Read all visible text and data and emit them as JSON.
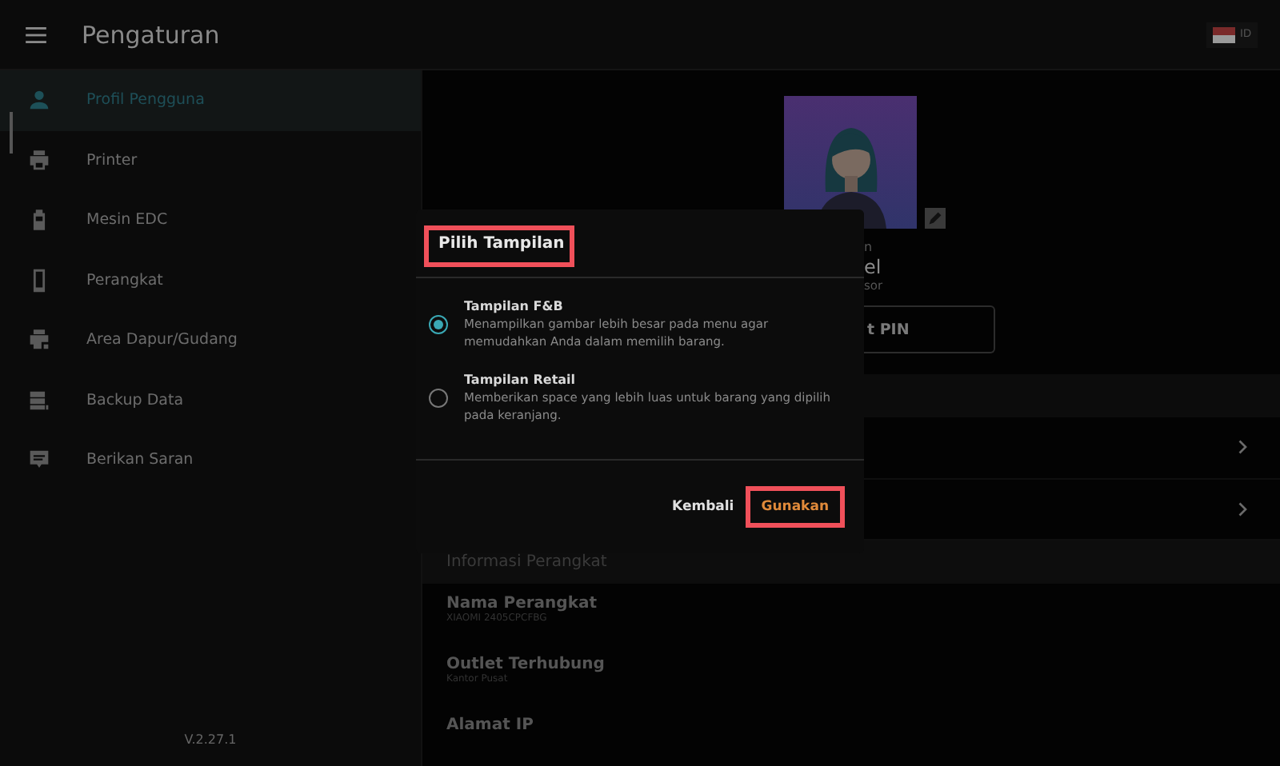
{
  "header": {
    "title": "Pengaturan",
    "language": "ID"
  },
  "sidebar": {
    "items": [
      {
        "label": "Profil Pengguna",
        "kind": "person",
        "selected": true
      },
      {
        "label": "Printer",
        "kind": "printer",
        "selected": false
      },
      {
        "label": "Mesin EDC",
        "kind": "edc",
        "selected": false
      },
      {
        "label": "Perangkat",
        "kind": "phone",
        "selected": false
      },
      {
        "label": "Area Dapur/Gudang",
        "kind": "kitchen",
        "selected": false
      },
      {
        "label": "Backup Data",
        "kind": "backup",
        "selected": false
      },
      {
        "label": "Berikan Saran",
        "kind": "feedback",
        "selected": false
      }
    ],
    "version": "V.2.27.1"
  },
  "profile": {
    "line_1": "n",
    "line_2": "el",
    "line_3": "sor",
    "pin_button": "t PIN"
  },
  "device_info": {
    "heading": "Informasi Perangkat",
    "rows": [
      {
        "label": "Nama Perangkat",
        "value": "XIAOMI 2405CPCFBG"
      },
      {
        "label": "Outlet Terhubung",
        "value": "Kantor Pusat"
      },
      {
        "label": "Alamat IP"
      }
    ]
  },
  "dialog": {
    "title": "Pilih Tampilan",
    "options": [
      {
        "label": "Tampilan F&B",
        "description": "Menampilkan gambar lebih besar pada menu agar memudahkan Anda dalam memilih barang.",
        "selected": true
      },
      {
        "label": "Tampilan Retail",
        "description": "Memberikan space yang lebih luas untuk barang yang dipilih pada keranjang.",
        "selected": false
      }
    ],
    "cancel": "Kembali",
    "confirm": "Gunakan"
  }
}
